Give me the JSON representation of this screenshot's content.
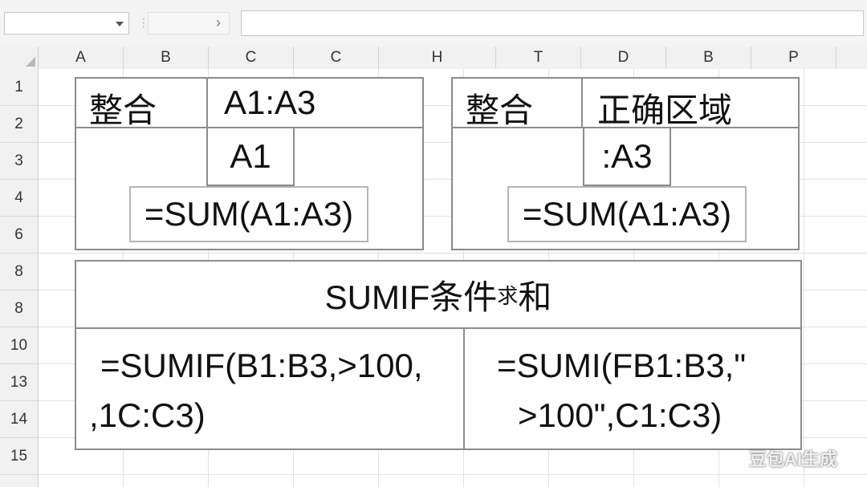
{
  "columns": [
    "A",
    "B",
    "C",
    "C",
    "H",
    "T",
    "D",
    "B",
    "P"
  ],
  "rows": [
    "1",
    "2",
    "3",
    "4",
    "6",
    "8",
    "8",
    "10",
    "13",
    "14",
    "15"
  ],
  "left_box": {
    "label": "整合",
    "range": "A1:A3",
    "cell": "A1",
    "formula": "=SUM(A1:A3)"
  },
  "right_box": {
    "label": "整合",
    "range": "正确区域",
    "cell": ":A3",
    "formula": "=SUM(A1:A3)"
  },
  "sumif_box": {
    "title": "SUMIF条件",
    "title_small": "求",
    "title_end": "和",
    "left_line1": "=SUMIF(B1:B3,>100,",
    "left_line2": ",1C:C3)",
    "right_line1": "=SUMI(FB1:B3,\"",
    "right_line2": ">100\",C1:C3)"
  },
  "watermark": "豆包AI生成",
  "colors": {
    "header_bg": "#f1f1f1",
    "box_border": "#8c8c8c",
    "grid_line": "#e2e2e2"
  },
  "icons": [
    "dropdown-arrow-icon",
    "chevron-right-icon",
    "select-all-icon"
  ]
}
